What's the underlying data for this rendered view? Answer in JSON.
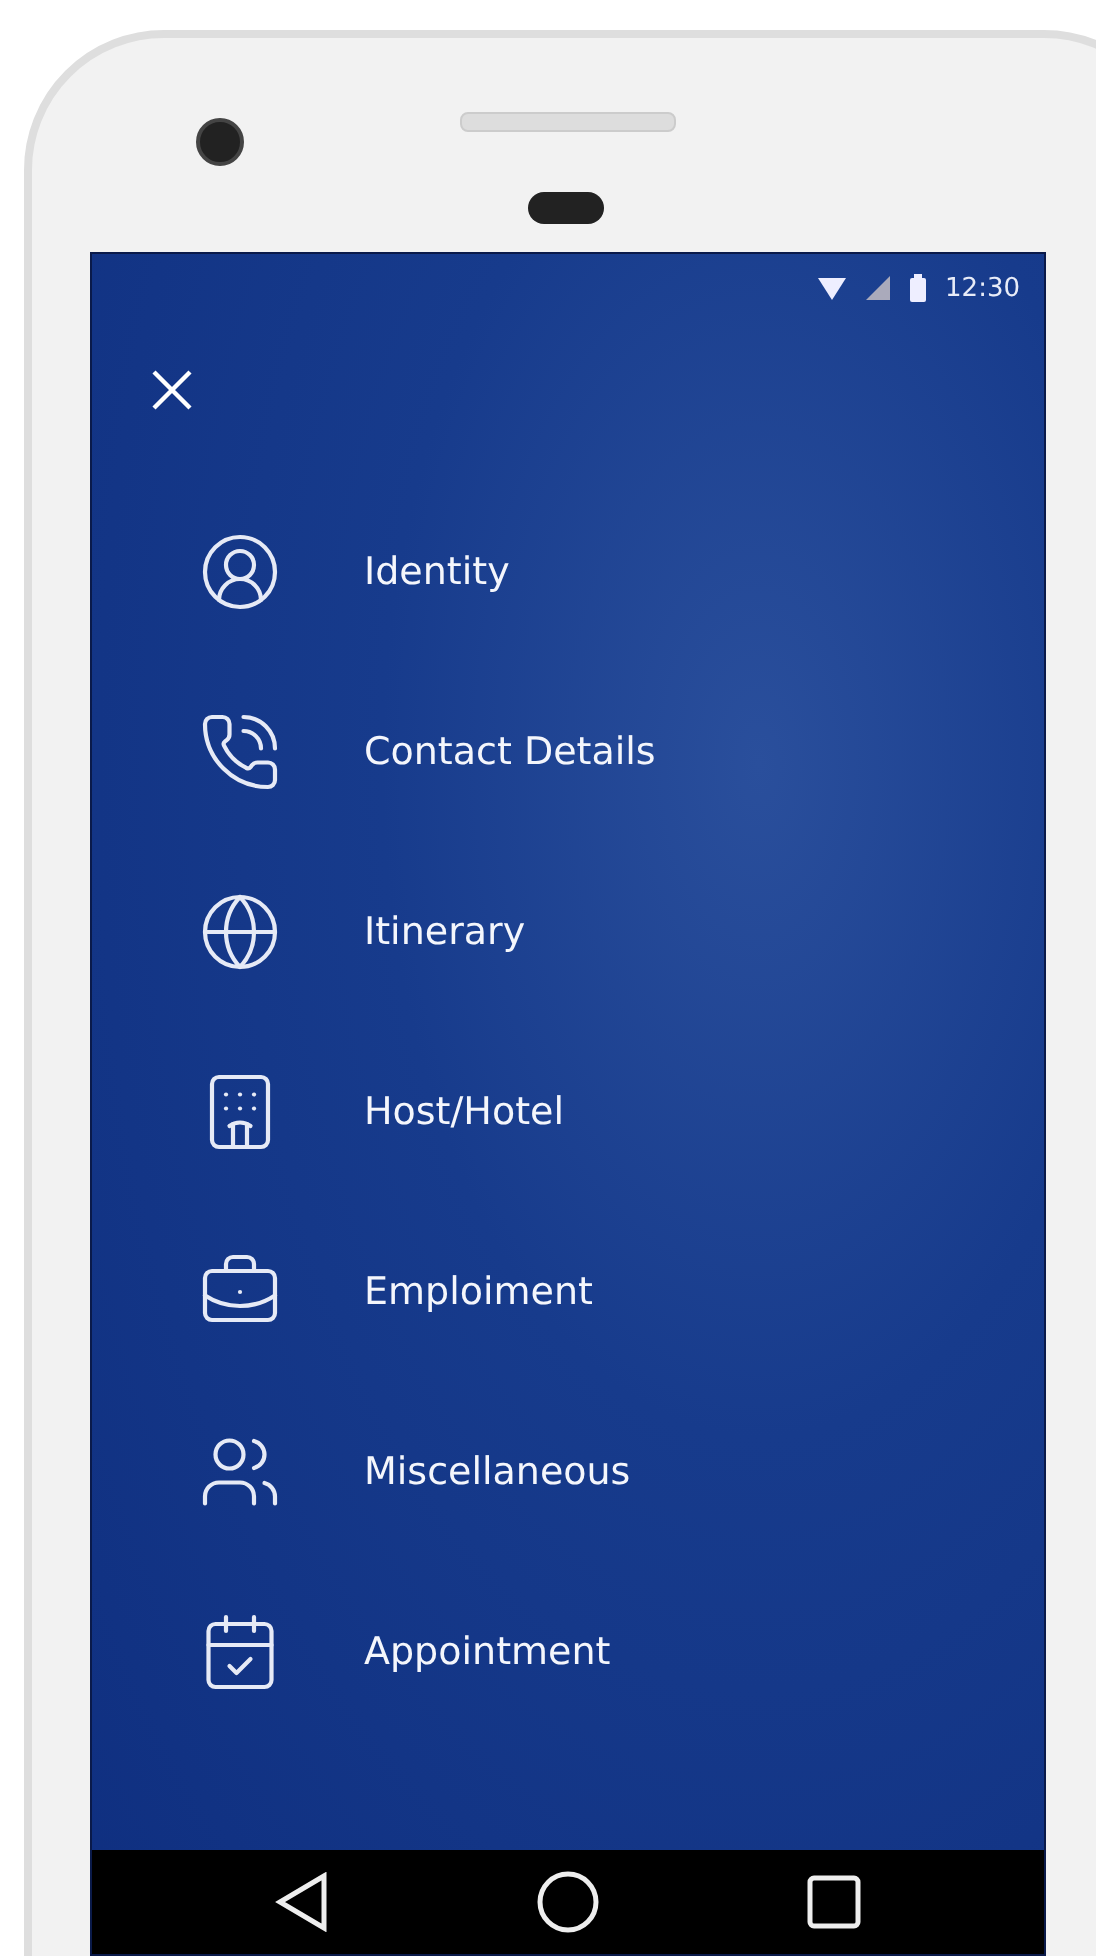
{
  "status_bar": {
    "time": "12:30"
  },
  "menu": [
    {
      "label": "Identity",
      "kind": "identity"
    },
    {
      "label": "Contact Details",
      "kind": "contact"
    },
    {
      "label": "Itinerary",
      "kind": "itinerary"
    },
    {
      "label": "Host/Hotel",
      "kind": "hotel"
    },
    {
      "label": "Emploiment",
      "kind": "employment"
    },
    {
      "label": "Miscellaneous",
      "kind": "misc"
    },
    {
      "label": "Appointment",
      "kind": "appointment"
    }
  ]
}
